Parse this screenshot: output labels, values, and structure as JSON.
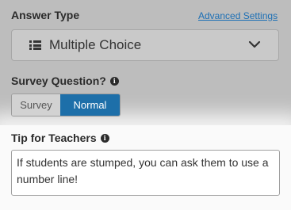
{
  "answer_type": {
    "label": "Answer Type",
    "advanced_link": "Advanced Settings",
    "select_value": "Multiple Choice",
    "select_icon": "list-icon",
    "dropdown_icon": "chevron-down-icon"
  },
  "survey_question": {
    "label": "Survey Question?",
    "info_icon": "info-icon",
    "options": [
      "Survey",
      "Normal"
    ],
    "selected": "Normal"
  },
  "tip": {
    "label": "Tip for Teachers",
    "info_icon": "info-icon",
    "text": "If students are stumped, you can ask them to use a number line!"
  },
  "colors": {
    "link": "#1c6fb5",
    "selected_toggle": "#1d6fa9"
  }
}
